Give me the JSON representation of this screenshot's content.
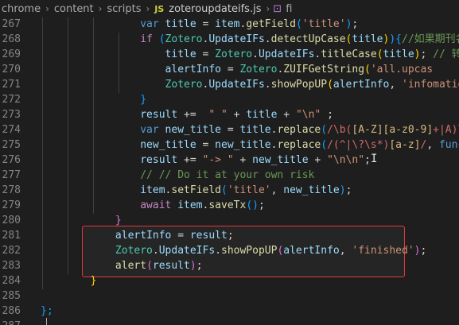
{
  "breadcrumb": {
    "items": [
      "chrome",
      "content",
      "scripts",
      "zoteroupdateifs.js"
    ],
    "file_badge": "JS",
    "trailing_symbol": "⊡",
    "trailing": "fi"
  },
  "lines": [
    {
      "n": "267",
      "tokens": [
        {
          "t": "                ",
          "c": "op"
        },
        {
          "t": "var",
          "c": "kw"
        },
        {
          "t": " ",
          "c": "op"
        },
        {
          "t": "title",
          "c": "var"
        },
        {
          "t": " = ",
          "c": "op"
        },
        {
          "t": "item",
          "c": "var"
        },
        {
          "t": ".",
          "c": "op"
        },
        {
          "t": "getField",
          "c": "fn"
        },
        {
          "t": "(",
          "c": "br3"
        },
        {
          "t": "'title'",
          "c": "str"
        },
        {
          "t": ")",
          "c": "br3"
        },
        {
          "t": ";",
          "c": "op"
        }
      ]
    },
    {
      "n": "268",
      "tokens": [
        {
          "t": "                ",
          "c": "op"
        },
        {
          "t": "if",
          "c": "ctl"
        },
        {
          "t": " ",
          "c": "op"
        },
        {
          "t": "(",
          "c": "br3"
        },
        {
          "t": "Zotero",
          "c": "cls"
        },
        {
          "t": ".",
          "c": "op"
        },
        {
          "t": "UpdateIFs",
          "c": "var"
        },
        {
          "t": ".",
          "c": "op"
        },
        {
          "t": "detectUpCase",
          "c": "fn"
        },
        {
          "t": "(",
          "c": "br1"
        },
        {
          "t": "title",
          "c": "var"
        },
        {
          "t": ")",
          "c": "br1"
        },
        {
          "t": ")",
          "c": "br3"
        },
        {
          "t": "{",
          "c": "br3"
        },
        {
          "t": "//如果期刊名全部",
          "c": "cm"
        }
      ]
    },
    {
      "n": "269",
      "tokens": [
        {
          "t": "                    ",
          "c": "op"
        },
        {
          "t": "title",
          "c": "var"
        },
        {
          "t": " = ",
          "c": "op"
        },
        {
          "t": "Zotero",
          "c": "cls"
        },
        {
          "t": ".",
          "c": "op"
        },
        {
          "t": "UpdateIFs",
          "c": "var"
        },
        {
          "t": ".",
          "c": "op"
        },
        {
          "t": "titleCase",
          "c": "fn"
        },
        {
          "t": "(",
          "c": "br1"
        },
        {
          "t": "title",
          "c": "var"
        },
        {
          "t": ")",
          "c": "br1"
        },
        {
          "t": "; ",
          "c": "op"
        },
        {
          "t": "// 转换为单",
          "c": "cm"
        }
      ]
    },
    {
      "n": "270",
      "tokens": [
        {
          "t": "                    ",
          "c": "op"
        },
        {
          "t": "alertInfo",
          "c": "var"
        },
        {
          "t": " = ",
          "c": "op"
        },
        {
          "t": "Zotero",
          "c": "cls"
        },
        {
          "t": ".",
          "c": "op"
        },
        {
          "t": "ZUIFGetString",
          "c": "fn"
        },
        {
          "t": "(",
          "c": "br1"
        },
        {
          "t": "'all.upcas",
          "c": "str"
        }
      ]
    },
    {
      "n": "271",
      "tokens": [
        {
          "t": "                    ",
          "c": "op"
        },
        {
          "t": "Zotero",
          "c": "cls"
        },
        {
          "t": ".",
          "c": "op"
        },
        {
          "t": "UpdateIFs",
          "c": "var"
        },
        {
          "t": ".",
          "c": "op"
        },
        {
          "t": "showPopUP",
          "c": "fn"
        },
        {
          "t": "(",
          "c": "br1"
        },
        {
          "t": "alertInfo",
          "c": "var"
        },
        {
          "t": ", ",
          "c": "op"
        },
        {
          "t": "'infomation'",
          "c": "str"
        },
        {
          "t": ")",
          "c": "br1"
        },
        {
          "t": ";",
          "c": "op"
        }
      ]
    },
    {
      "n": "272",
      "tokens": [
        {
          "t": "                ",
          "c": "op"
        },
        {
          "t": "}",
          "c": "br3"
        }
      ]
    },
    {
      "n": "273",
      "tokens": [
        {
          "t": "                ",
          "c": "op"
        },
        {
          "t": "result",
          "c": "var"
        },
        {
          "t": " += ",
          "c": "op"
        },
        {
          "t": " \" \"",
          "c": "str"
        },
        {
          "t": " + ",
          "c": "op"
        },
        {
          "t": "title",
          "c": "var"
        },
        {
          "t": " + ",
          "c": "op"
        },
        {
          "t": "\"\\n\"",
          "c": "str"
        },
        {
          "t": " ;",
          "c": "op"
        }
      ]
    },
    {
      "n": "274",
      "tokens": [
        {
          "t": "                ",
          "c": "op"
        },
        {
          "t": "var",
          "c": "kw"
        },
        {
          "t": " ",
          "c": "op"
        },
        {
          "t": "new_title",
          "c": "var"
        },
        {
          "t": " = ",
          "c": "op"
        },
        {
          "t": "title",
          "c": "var"
        },
        {
          "t": ".",
          "c": "op"
        },
        {
          "t": "replace",
          "c": "fn"
        },
        {
          "t": "(",
          "c": "br3"
        },
        {
          "t": "/\\b(",
          "c": "rx"
        },
        {
          "t": "[A-Z]",
          "c": "rxe"
        },
        {
          "t": "[a-z0-9]",
          "c": "rxe"
        },
        {
          "t": "+|A)\\b/g",
          "c": "rx"
        },
        {
          "t": ",",
          "c": "op"
        }
      ]
    },
    {
      "n": "275",
      "tokens": [
        {
          "t": "                ",
          "c": "op"
        },
        {
          "t": "new_title",
          "c": "var"
        },
        {
          "t": " = ",
          "c": "op"
        },
        {
          "t": "new_title",
          "c": "var"
        },
        {
          "t": ".",
          "c": "op"
        },
        {
          "t": "replace",
          "c": "fn"
        },
        {
          "t": "(",
          "c": "br3"
        },
        {
          "t": "/(^|\\?\\s*)",
          "c": "rx"
        },
        {
          "t": "[a-z]",
          "c": "rxe"
        },
        {
          "t": "/",
          "c": "rx"
        },
        {
          "t": ", ",
          "c": "op"
        },
        {
          "t": "function",
          "c": "kw"
        }
      ]
    },
    {
      "n": "276",
      "tokens": [
        {
          "t": "                ",
          "c": "op"
        },
        {
          "t": "result",
          "c": "var"
        },
        {
          "t": " += ",
          "c": "op"
        },
        {
          "t": "\"-> \"",
          "c": "str"
        },
        {
          "t": " + ",
          "c": "op"
        },
        {
          "t": "new_title",
          "c": "var"
        },
        {
          "t": " + ",
          "c": "op"
        },
        {
          "t": "\"\\n\\n\"",
          "c": "str"
        },
        {
          "t": ";",
          "c": "op"
        }
      ]
    },
    {
      "n": "277",
      "tokens": [
        {
          "t": "                ",
          "c": "op"
        },
        {
          "t": "// // Do it at your own risk",
          "c": "cm"
        }
      ]
    },
    {
      "n": "278",
      "tokens": [
        {
          "t": "                ",
          "c": "op"
        },
        {
          "t": "item",
          "c": "var"
        },
        {
          "t": ".",
          "c": "op"
        },
        {
          "t": "setField",
          "c": "fn"
        },
        {
          "t": "(",
          "c": "br3"
        },
        {
          "t": "'title'",
          "c": "str"
        },
        {
          "t": ", ",
          "c": "op"
        },
        {
          "t": "new_title",
          "c": "var"
        },
        {
          "t": ")",
          "c": "br3"
        },
        {
          "t": ";",
          "c": "op"
        }
      ]
    },
    {
      "n": "279",
      "tokens": [
        {
          "t": "                ",
          "c": "op"
        },
        {
          "t": "await",
          "c": "ctl"
        },
        {
          "t": " ",
          "c": "op"
        },
        {
          "t": "item",
          "c": "var"
        },
        {
          "t": ".",
          "c": "op"
        },
        {
          "t": "saveTx",
          "c": "fn"
        },
        {
          "t": "()",
          "c": "br3"
        },
        {
          "t": ";",
          "c": "op"
        }
      ]
    },
    {
      "n": "280",
      "tokens": [
        {
          "t": "            ",
          "c": "op"
        },
        {
          "t": "}",
          "c": "br2"
        }
      ]
    },
    {
      "n": "281",
      "tokens": [
        {
          "t": "            ",
          "c": "op"
        },
        {
          "t": "alertInfo",
          "c": "var"
        },
        {
          "t": " = ",
          "c": "op"
        },
        {
          "t": "result",
          "c": "var"
        },
        {
          "t": ";",
          "c": "op"
        }
      ]
    },
    {
      "n": "282",
      "tokens": [
        {
          "t": "            ",
          "c": "op"
        },
        {
          "t": "Zotero",
          "c": "cls"
        },
        {
          "t": ".",
          "c": "op"
        },
        {
          "t": "UpdateIFs",
          "c": "var"
        },
        {
          "t": ".",
          "c": "op"
        },
        {
          "t": "showPopUP",
          "c": "fn"
        },
        {
          "t": "(",
          "c": "br2"
        },
        {
          "t": "alertInfo",
          "c": "var"
        },
        {
          "t": ", ",
          "c": "op"
        },
        {
          "t": "'finished'",
          "c": "str"
        },
        {
          "t": ")",
          "c": "br2"
        },
        {
          "t": ";",
          "c": "op"
        }
      ]
    },
    {
      "n": "283",
      "tokens": [
        {
          "t": "            ",
          "c": "op"
        },
        {
          "t": "alert",
          "c": "fn"
        },
        {
          "t": "(",
          "c": "br2"
        },
        {
          "t": "result",
          "c": "var"
        },
        {
          "t": ")",
          "c": "br2"
        },
        {
          "t": ";",
          "c": "op"
        }
      ]
    },
    {
      "n": "284",
      "tokens": [
        {
          "t": "        ",
          "c": "op"
        },
        {
          "t": "}",
          "c": "br1"
        }
      ]
    },
    {
      "n": "285",
      "tokens": []
    },
    {
      "n": "286",
      "tokens": [
        {
          "t": "};",
          "c": "br3"
        }
      ]
    },
    {
      "n": "287",
      "tokens": []
    }
  ],
  "colors": {
    "background": "#1e1e1e",
    "highlight_border": "#e0383e",
    "line_number": "#858585"
  }
}
